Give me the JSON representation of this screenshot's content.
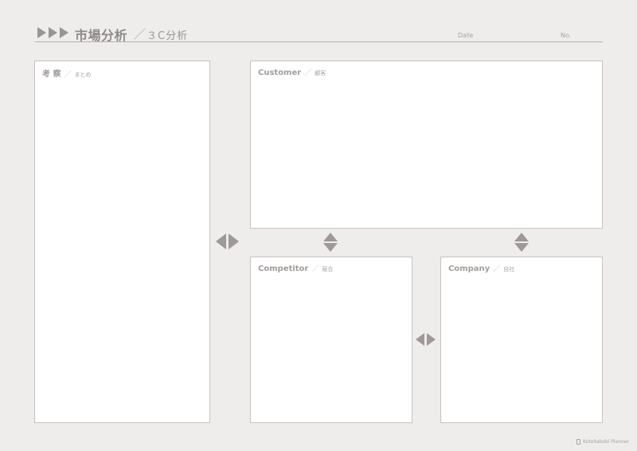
{
  "header": {
    "title": "市場分析",
    "separator": "／",
    "subtitle": "３C分析",
    "date_label": "Date",
    "no_label": "No."
  },
  "boxes": {
    "summary": {
      "label": "考 察",
      "separator": "／",
      "sub": "まとめ"
    },
    "customer": {
      "label": "Customer",
      "separator": "／",
      "sub": "顧客"
    },
    "competitor": {
      "label": "Competitor",
      "separator": "／",
      "sub": "競合"
    },
    "company": {
      "label": "Company",
      "separator": "／",
      "sub": "自社"
    }
  },
  "icons": {
    "header_arrows": "triple-right-triangle",
    "bidirectional_h": "left-right-triangles",
    "bidirectional_v": "up-down-triangles"
  },
  "colors": {
    "background": "#eeedeb",
    "box_fill": "#ffffff",
    "box_border": "#c6c2c0",
    "accent_gray": "#9a9592"
  },
  "footer": {
    "brand": "Kotohakobi Planner"
  }
}
